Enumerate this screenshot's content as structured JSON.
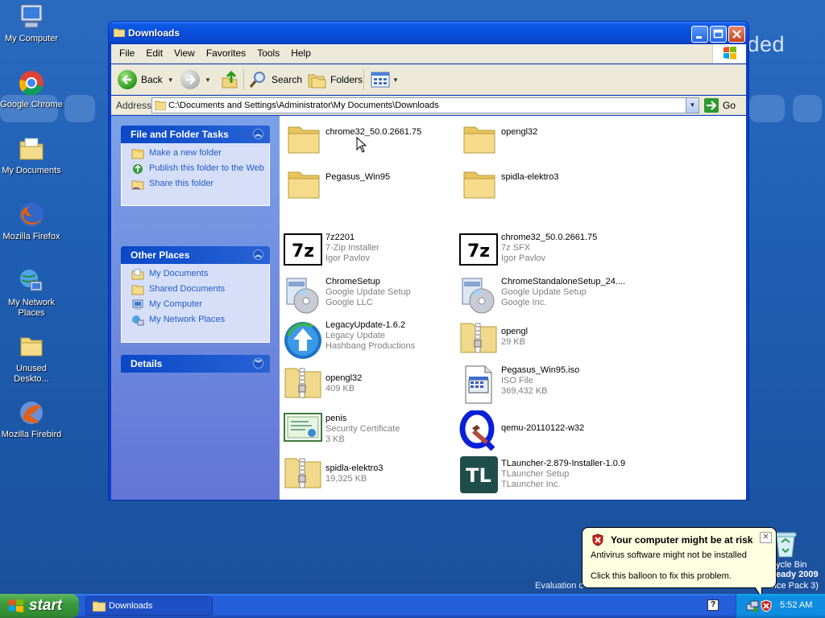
{
  "desktop": {
    "wallpaper_text": "dded",
    "evaluation_text": "Evaluation c",
    "version_text": "eady 2009",
    "service_pack_text": "vice Pack 3)",
    "icons": [
      {
        "label": "My Computer",
        "icon": "my-computer-icon"
      },
      {
        "label": "Google Chrome",
        "icon": "chrome-icon"
      },
      {
        "label": "My Documents",
        "icon": "my-documents-icon"
      },
      {
        "label": "Mozilla Firefox",
        "icon": "firefox-icon"
      },
      {
        "label": "My Network Places",
        "icon": "network-places-icon"
      },
      {
        "label": "Unused Deskto...",
        "icon": "folder-icon"
      },
      {
        "label": "Mozilla Firebird",
        "icon": "firebird-icon"
      }
    ],
    "recycle_bin_label": "ycle Bin"
  },
  "window": {
    "title": "Downloads",
    "menu": [
      "File",
      "Edit",
      "View",
      "Favorites",
      "Tools",
      "Help"
    ],
    "toolbar": {
      "back_label": "Back",
      "search_label": "Search",
      "folders_label": "Folders"
    },
    "address": {
      "label": "Address",
      "value": "C:\\Documents and Settings\\Administrator\\My Documents\\Downloads",
      "go_label": "Go"
    }
  },
  "left_panel": {
    "file_tasks": {
      "title": "File and Folder Tasks",
      "items": [
        "Make a new folder",
        "Publish this folder to the Web",
        "Share this folder"
      ]
    },
    "other_places": {
      "title": "Other Places",
      "items": [
        "My Documents",
        "Shared Documents",
        "My Computer",
        "My Network Places"
      ]
    },
    "details": {
      "title": "Details"
    }
  },
  "files": [
    {
      "name": "chrome32_50.0.2661.75",
      "line2": "",
      "line3": "",
      "icon": "folder-icon"
    },
    {
      "name": "opengl32",
      "line2": "",
      "line3": "",
      "icon": "folder-icon"
    },
    {
      "name": "Pegasus_Win95",
      "line2": "",
      "line3": "",
      "icon": "folder-icon"
    },
    {
      "name": "spidla-elektro3",
      "line2": "",
      "line3": "",
      "icon": "folder-icon"
    },
    {
      "name": "7z2201",
      "line2": "7-Zip Installer",
      "line3": "Igor Pavlov",
      "icon": "7zip-icon"
    },
    {
      "name": "chrome32_50.0.2661.75",
      "line2": "7z SFX",
      "line3": "Igor Pavlov",
      "icon": "7zip-icon"
    },
    {
      "name": "ChromeSetup",
      "line2": "Google Update Setup",
      "line3": "Google LLC",
      "icon": "setup-icon"
    },
    {
      "name": "ChromeStandaloneSetup_24....",
      "line2": "Google Update Setup",
      "line3": "Google Inc.",
      "icon": "setup-icon"
    },
    {
      "name": "LegacyUpdate-1.6.2",
      "line2": "Legacy Update",
      "line3": "Hashbang Productions",
      "icon": "legacy-update-icon"
    },
    {
      "name": "opengl",
      "line2": "29 KB",
      "line3": "",
      "icon": "zip-folder-icon"
    },
    {
      "name": "opengl32",
      "line2": "409 KB",
      "line3": "",
      "icon": "zip-folder-icon"
    },
    {
      "name": "Pegasus_Win95.iso",
      "line2": "ISO File",
      "line3": "369,432 KB",
      "icon": "iso-file-icon"
    },
    {
      "name": "penis",
      "line2": "Security Certificate",
      "line3": "3 KB",
      "icon": "certificate-icon"
    },
    {
      "name": "qemu-20110122-w32",
      "line2": "",
      "line3": "",
      "icon": "qemu-icon"
    },
    {
      "name": "spidla-elektro3",
      "line2": "19,325 KB",
      "line3": "",
      "icon": "zip-folder-icon"
    },
    {
      "name": "TLauncher-2.879-Installer-1.0.9",
      "line2": "TLauncher Setup",
      "line3": "TLauncher Inc.",
      "icon": "tlauncher-icon"
    }
  ],
  "balloon": {
    "title": "Your computer might be at risk",
    "line1": "Antivirus software might not be installed",
    "line2": "Click this balloon to fix this problem."
  },
  "taskbar": {
    "start_label": "start",
    "task_label": "Downloads",
    "clock": "5:52 AM"
  }
}
